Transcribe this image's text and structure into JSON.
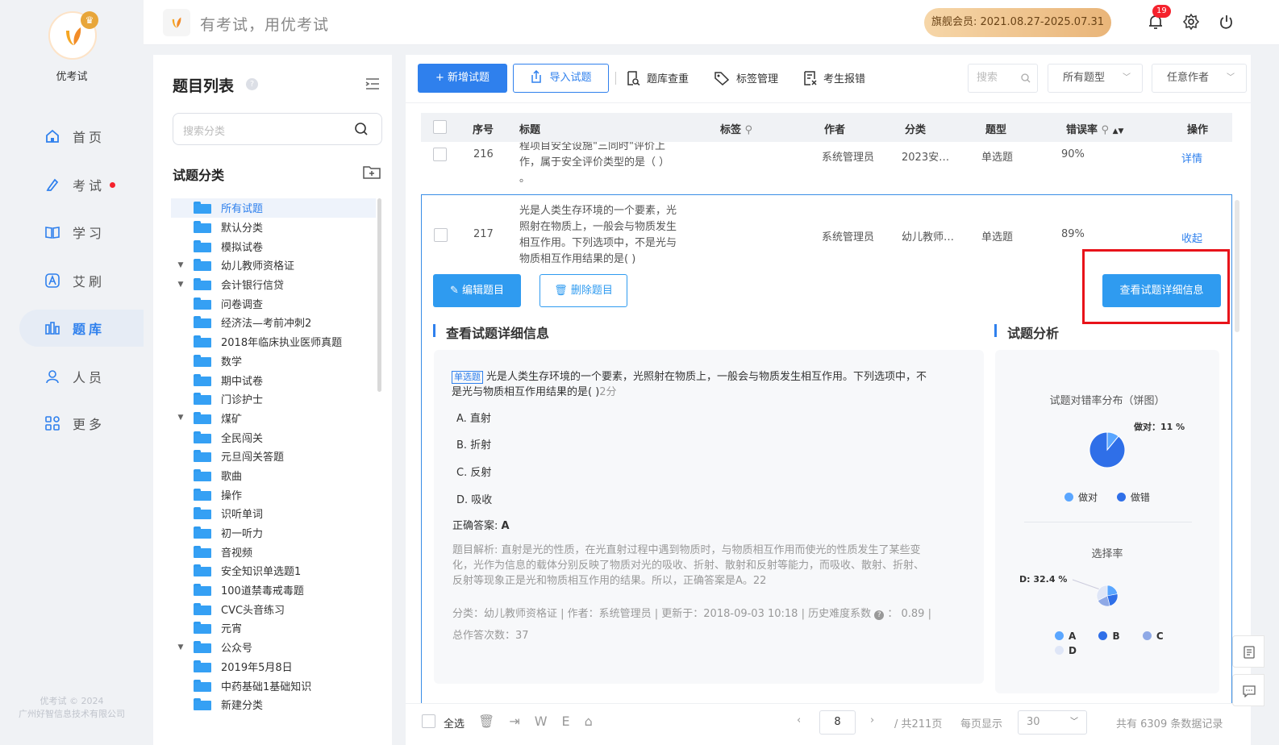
{
  "app": {
    "name": "优考试",
    "slogan": "有考试，用优考试",
    "footer_line1": "优考试 © 2024",
    "footer_line2": "广州好智信息技术有限公司"
  },
  "colors": {
    "accent": "#2f80ed",
    "danger": "#e8131a",
    "member_gold": "#e9b579"
  },
  "nav": {
    "items": [
      {
        "label": "首页",
        "icon": "home-icon"
      },
      {
        "label": "考试",
        "icon": "pen-icon"
      },
      {
        "label": "学习",
        "icon": "book-icon"
      },
      {
        "label": "艾刷",
        "icon": "a-badge-icon"
      },
      {
        "label": "题库",
        "icon": "bar-chart-icon"
      },
      {
        "label": "人员",
        "icon": "user-icon"
      },
      {
        "label": "更多",
        "icon": "grid-icon"
      }
    ]
  },
  "topbar": {
    "member_text": "旗舰会员: 2021.08.27-2025.07.31",
    "notification_count": "19"
  },
  "categories": {
    "title": "题目列表",
    "help": "?",
    "search_placeholder": "搜索分类",
    "subtitle": "试题分类",
    "items": [
      {
        "label": "所有试题",
        "arrow": ""
      },
      {
        "label": "默认分类",
        "arrow": ""
      },
      {
        "label": "模拟试卷",
        "arrow": ""
      },
      {
        "label": "幼儿教师资格证",
        "arrow": "▼"
      },
      {
        "label": "会计银行信贷",
        "arrow": "▼"
      },
      {
        "label": "问卷调查",
        "arrow": ""
      },
      {
        "label": "经济法—考前冲刺2",
        "arrow": ""
      },
      {
        "label": "2018年临床执业医师真题",
        "arrow": ""
      },
      {
        "label": "数学",
        "arrow": ""
      },
      {
        "label": "期中试卷",
        "arrow": ""
      },
      {
        "label": "门诊护士",
        "arrow": ""
      },
      {
        "label": "煤矿",
        "arrow": "▼"
      },
      {
        "label": "全民闯关",
        "arrow": ""
      },
      {
        "label": "元旦闯关答题",
        "arrow": ""
      },
      {
        "label": "歌曲",
        "arrow": ""
      },
      {
        "label": "操作",
        "arrow": ""
      },
      {
        "label": "识听单词",
        "arrow": ""
      },
      {
        "label": "初一听力",
        "arrow": ""
      },
      {
        "label": "音视频",
        "arrow": ""
      },
      {
        "label": "安全知识单选题1",
        "arrow": ""
      },
      {
        "label": "100道禁毒戒毒题",
        "arrow": ""
      },
      {
        "label": "CVC头音练习",
        "arrow": ""
      },
      {
        "label": "元宵",
        "arrow": ""
      },
      {
        "label": "公众号",
        "arrow": "▼"
      },
      {
        "label": "2019年5月8日",
        "arrow": ""
      },
      {
        "label": "中药基础1基础知识",
        "arrow": ""
      },
      {
        "label": "新建分类",
        "arrow": ""
      }
    ]
  },
  "toolbar": {
    "add_label": "+ 新增试题",
    "import_label": "导入试题",
    "dedupe_label": "题库查重",
    "tag_label": "标签管理",
    "report_label": "考生报错",
    "search_placeholder": "搜索",
    "type_select": "所有题型",
    "author_select": "任意作者"
  },
  "table": {
    "headers": {
      "seq": "序号",
      "title": "标题",
      "tag": "标签",
      "author": "作者",
      "category": "分类",
      "type": "题型",
      "error_rate": "错误率",
      "action": "操作"
    },
    "row1": {
      "seq": "216",
      "title_l1": "程项目安全设施\"三同时\"评价上",
      "title_l2": "作，属于安全评价类型的是（ ）",
      "title_l3": "。",
      "author": "系统管理员",
      "category": "2023安…",
      "type": "单选题",
      "error_rate": "90%",
      "action": "详情"
    },
    "row2": {
      "seq": "217",
      "title_l1": "光是人类生存环境的一个要素，光",
      "title_l2": "照射在物质上，一般会与物质发生",
      "title_l3": "相互作用。下列选项中，不是光与",
      "title_l4": "物质相互作用结果的是( )",
      "author": "系统管理员",
      "category": "幼儿教师…",
      "type": "单选题",
      "error_rate": "89%",
      "action": "收起"
    }
  },
  "detail": {
    "edit_btn": "编辑题目",
    "delete_btn": "删除题目",
    "view_detail_btn": "查看试题详细信息",
    "section_title": "查看试题详细信息",
    "analysis_title": "试题分析",
    "q_tag": "单选题",
    "q_text_l1": "光是人类生存环境的一个要素，光照射在物质上，一般会与物质发生相互作用。下列选项中，不",
    "q_text_l2": "是光与物质相互作用结果的是( )",
    "q_score": "2分",
    "options": [
      "A. 直射",
      "B. 折射",
      "C. 反射",
      "D. 吸收"
    ],
    "answer_label": "正确答案:",
    "answer_value": "A",
    "explain_l1": "题目解析:  直射是光的性质，在光直射过程中遇到物质时，与物质相互作用而使光的性质发生了某些变",
    "explain_l2": "化，光作为信息的载体分别反映了物质对光的吸收、折射、散射和反射等能力，而吸收、散射、折射、",
    "explain_l3": "反射等现象正是光和物质相互作用的结果。所以，正确答案是A。22",
    "meta_l1": "分类：幼儿教师资格证 | 作者：系统管理员 | 更新于：2018-09-03 10:18 | 历史难度系数",
    "meta_difficulty": "： 0.89 |",
    "meta_l2": "总作答次数：37"
  },
  "analysis": {
    "pie1_title": "试题对错率分布（饼图）",
    "pie1_label": "做对：11 %",
    "pie1_correct_pct": 11,
    "legend1": [
      "做对",
      "做错"
    ],
    "pie2_title": "选择率",
    "pie2_label": "D: 32.4 %",
    "pie2_values": {
      "A": 22.0,
      "B": 24.0,
      "C": 21.6,
      "D": 32.4
    },
    "legend2": [
      "A",
      "B",
      "C",
      "D"
    ],
    "pie_colors": [
      "#5aa6ff",
      "#2f6fe8",
      "#8fa9e6",
      "#dfe6f7"
    ]
  },
  "footer": {
    "select_all": "全选",
    "page_current": "8",
    "page_total": "/ 共211页",
    "per_page_label": "每页显示",
    "per_page_value": "30",
    "total_records": "共有 6309 条数据记录"
  }
}
